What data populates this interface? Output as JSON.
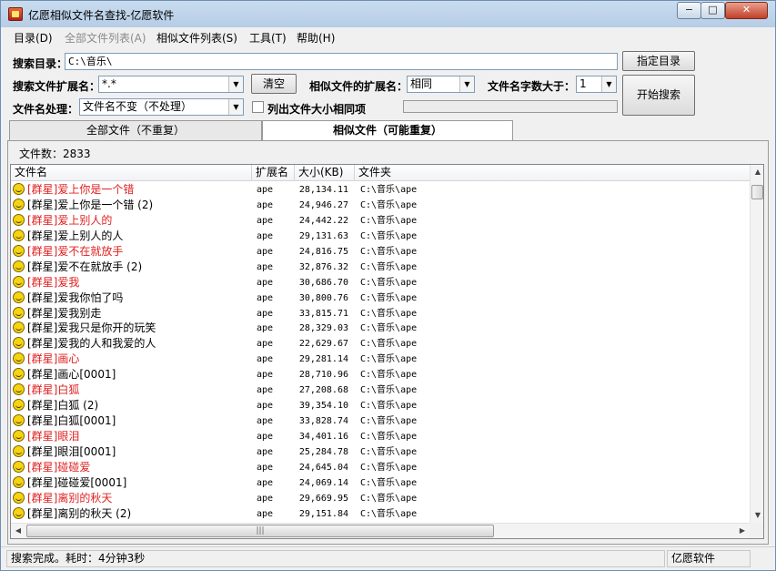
{
  "window": {
    "title": "亿愿相似文件名查找-亿愿软件",
    "min_glyph": "−",
    "max_glyph": "□",
    "close_glyph": "✕"
  },
  "menu": [
    {
      "label": "目录(D)",
      "enabled": true
    },
    {
      "label": "全部文件列表(A)",
      "enabled": false
    },
    {
      "label": "相似文件列表(S)",
      "enabled": true
    },
    {
      "label": "工具(T)",
      "enabled": true
    },
    {
      "label": "帮助(H)",
      "enabled": true
    }
  ],
  "search": {
    "dir_label": "搜索目录：",
    "dir_value": "C:\\音乐\\",
    "choose_dir_button": "指定目录",
    "ext_label": "搜索文件扩展名：",
    "ext_value": "*.*",
    "clear_button": "清空",
    "similar_ext_label": "相似文件的扩展名：",
    "similar_ext_value": "相同",
    "name_len_label": "文件名字数大于：",
    "name_len_value": "1",
    "start_button": "开始搜索",
    "name_proc_label": "文件名处理：",
    "name_proc_value": "文件名不变（不处理）",
    "list_same_size_label": "列出文件大小相同项"
  },
  "tabs": [
    {
      "label": "全部文件（不重复）",
      "active": false
    },
    {
      "label": "相似文件（可能重复）",
      "active": true
    }
  ],
  "file_count": "文件数：2833",
  "columns": {
    "name": "文件名",
    "ext": "扩展名",
    "size": "大小(KB)",
    "folder": "文件夹"
  },
  "rows": [
    {
      "name": "[群星]爱上你是一个错",
      "ext": "ape",
      "size": "28,134.11",
      "folder": "C:\\音乐\\ape",
      "dup": true
    },
    {
      "name": "[群星]爱上你是一个错 (2)",
      "ext": "ape",
      "size": "24,946.27",
      "folder": "C:\\音乐\\ape",
      "dup": false
    },
    {
      "name": "[群星]爱上别人的",
      "ext": "ape",
      "size": "24,442.22",
      "folder": "C:\\音乐\\ape",
      "dup": true
    },
    {
      "name": "[群星]爱上别人的人",
      "ext": "ape",
      "size": "29,131.63",
      "folder": "C:\\音乐\\ape",
      "dup": false
    },
    {
      "name": "[群星]爱不在就放手",
      "ext": "ape",
      "size": "24,816.75",
      "folder": "C:\\音乐\\ape",
      "dup": true
    },
    {
      "name": "[群星]爱不在就放手 (2)",
      "ext": "ape",
      "size": "32,876.32",
      "folder": "C:\\音乐\\ape",
      "dup": false
    },
    {
      "name": "[群星]爱我",
      "ext": "ape",
      "size": "30,686.70",
      "folder": "C:\\音乐\\ape",
      "dup": true
    },
    {
      "name": "[群星]爱我你怕了吗",
      "ext": "ape",
      "size": "30,800.76",
      "folder": "C:\\音乐\\ape",
      "dup": false
    },
    {
      "name": "[群星]爱我别走",
      "ext": "ape",
      "size": "33,815.71",
      "folder": "C:\\音乐\\ape",
      "dup": false
    },
    {
      "name": "[群星]爱我只是你开的玩笑",
      "ext": "ape",
      "size": "28,329.03",
      "folder": "C:\\音乐\\ape",
      "dup": false
    },
    {
      "name": "[群星]爱我的人和我爱的人",
      "ext": "ape",
      "size": "22,629.67",
      "folder": "C:\\音乐\\ape",
      "dup": false
    },
    {
      "name": "[群星]画心",
      "ext": "ape",
      "size": "29,281.14",
      "folder": "C:\\音乐\\ape",
      "dup": true
    },
    {
      "name": "[群星]画心[0001]",
      "ext": "ape",
      "size": "28,710.96",
      "folder": "C:\\音乐\\ape",
      "dup": false
    },
    {
      "name": "[群星]白狐",
      "ext": "ape",
      "size": "27,208.68",
      "folder": "C:\\音乐\\ape",
      "dup": true
    },
    {
      "name": "[群星]白狐 (2)",
      "ext": "ape",
      "size": "39,354.10",
      "folder": "C:\\音乐\\ape",
      "dup": false
    },
    {
      "name": "[群星]白狐[0001]",
      "ext": "ape",
      "size": "33,828.74",
      "folder": "C:\\音乐\\ape",
      "dup": false
    },
    {
      "name": "[群星]眼泪",
      "ext": "ape",
      "size": "34,401.16",
      "folder": "C:\\音乐\\ape",
      "dup": true
    },
    {
      "name": "[群星]眼泪[0001]",
      "ext": "ape",
      "size": "25,284.78",
      "folder": "C:\\音乐\\ape",
      "dup": false
    },
    {
      "name": "[群星]碰碰爱",
      "ext": "ape",
      "size": "24,645.04",
      "folder": "C:\\音乐\\ape",
      "dup": true
    },
    {
      "name": "[群星]碰碰爱[0001]",
      "ext": "ape",
      "size": "24,069.14",
      "folder": "C:\\音乐\\ape",
      "dup": false
    },
    {
      "name": "[群星]离别的秋天",
      "ext": "ape",
      "size": "29,669.95",
      "folder": "C:\\音乐\\ape",
      "dup": true
    },
    {
      "name": "[群星]离别的秋天 (2)",
      "ext": "ape",
      "size": "29,151.84",
      "folder": "C:\\音乐\\ape",
      "dup": false
    }
  ],
  "status": {
    "left": "搜索完成。耗时：4分钟3秒",
    "right": "亿愿软件"
  },
  "colors": {
    "duplicate_text": "#e02020",
    "title_bar": "#b5cde6"
  },
  "icons": {
    "row_icon": "smiley-icon",
    "app_icon": "app-icon"
  }
}
